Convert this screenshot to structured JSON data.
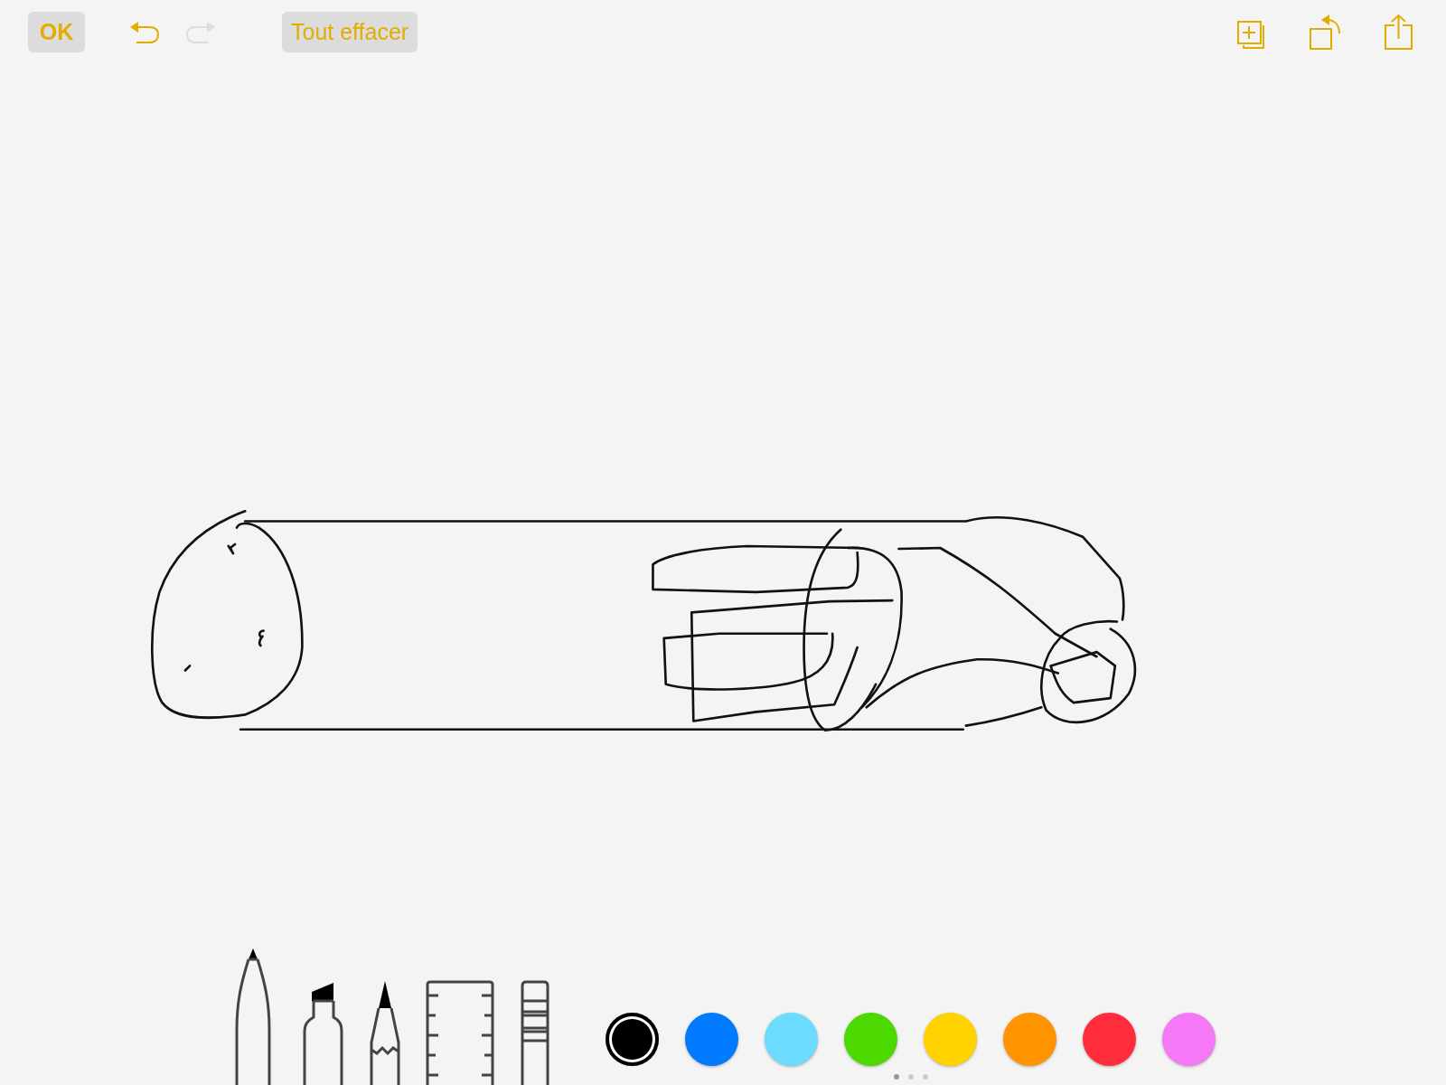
{
  "top_bar": {
    "done_button": "OK",
    "undo": {
      "disabled": false
    },
    "redo": {
      "disabled": true
    },
    "clear_button": "Tout effacer"
  },
  "tools": [
    {
      "kind": "pen",
      "selected": true
    },
    {
      "kind": "marker",
      "selected": false
    },
    {
      "kind": "pencil",
      "selected": false
    },
    {
      "kind": "ruler",
      "selected": false
    },
    {
      "kind": "eraser",
      "selected": false
    }
  ],
  "colors": [
    {
      "color": "#000000",
      "selected": true
    },
    {
      "color": "#007aff",
      "selected": false
    },
    {
      "color": "#6bdcff",
      "selected": false
    },
    {
      "color": "#4cd900",
      "selected": false
    },
    {
      "color": "#ffd200",
      "selected": false
    },
    {
      "color": "#ff9400",
      "selected": false
    },
    {
      "color": "#ff2d3c",
      "selected": false
    },
    {
      "color": "#f578f7",
      "selected": false
    }
  ],
  "palette_pages": [
    {
      "selected": true
    },
    {
      "selected": false
    },
    {
      "selected": false
    }
  ]
}
